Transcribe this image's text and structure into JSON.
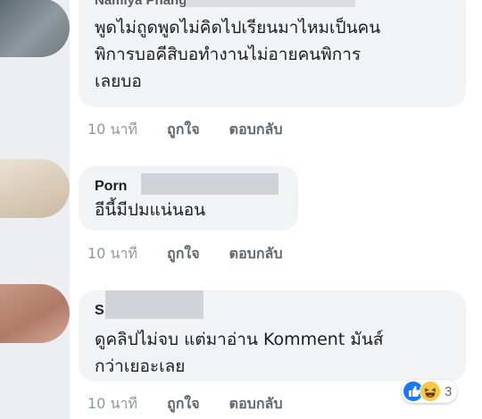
{
  "colors": {
    "bubble_bg": "#f2f3f5",
    "meta_text": "#8d949e",
    "like_blue": "#1877f2",
    "haha_yellow": "#f7c948"
  },
  "comments": [
    {
      "author": "Namiya Phangsara",
      "text": "พูดไม่ถูดพูดไม่คิดไปเรียนมาไหมเป็นคน\nพิการบอคีสิบอทำงานไม่อายคนพิการ\nเลยบอ",
      "time": "10 นาที",
      "like_label": "ถูกใจ",
      "reply_label": "ตอบกลับ"
    },
    {
      "author": "Porn",
      "text": "อีนี้มีปมแน่นอน",
      "time": "10 นาที",
      "like_label": "ถูกใจ",
      "reply_label": "ตอบกลับ"
    },
    {
      "author": "S",
      "text": "ดูคลิปไม่จบ แต่มาอ่าน Komment มันส์\nกว่าเยอะเลย",
      "time": "10 นาที",
      "like_label": "ถูกใจ",
      "reply_label": "ตอบกลับ",
      "reaction_icons": [
        "like-icon",
        "haha-icon"
      ],
      "reaction_count": "3"
    }
  ]
}
